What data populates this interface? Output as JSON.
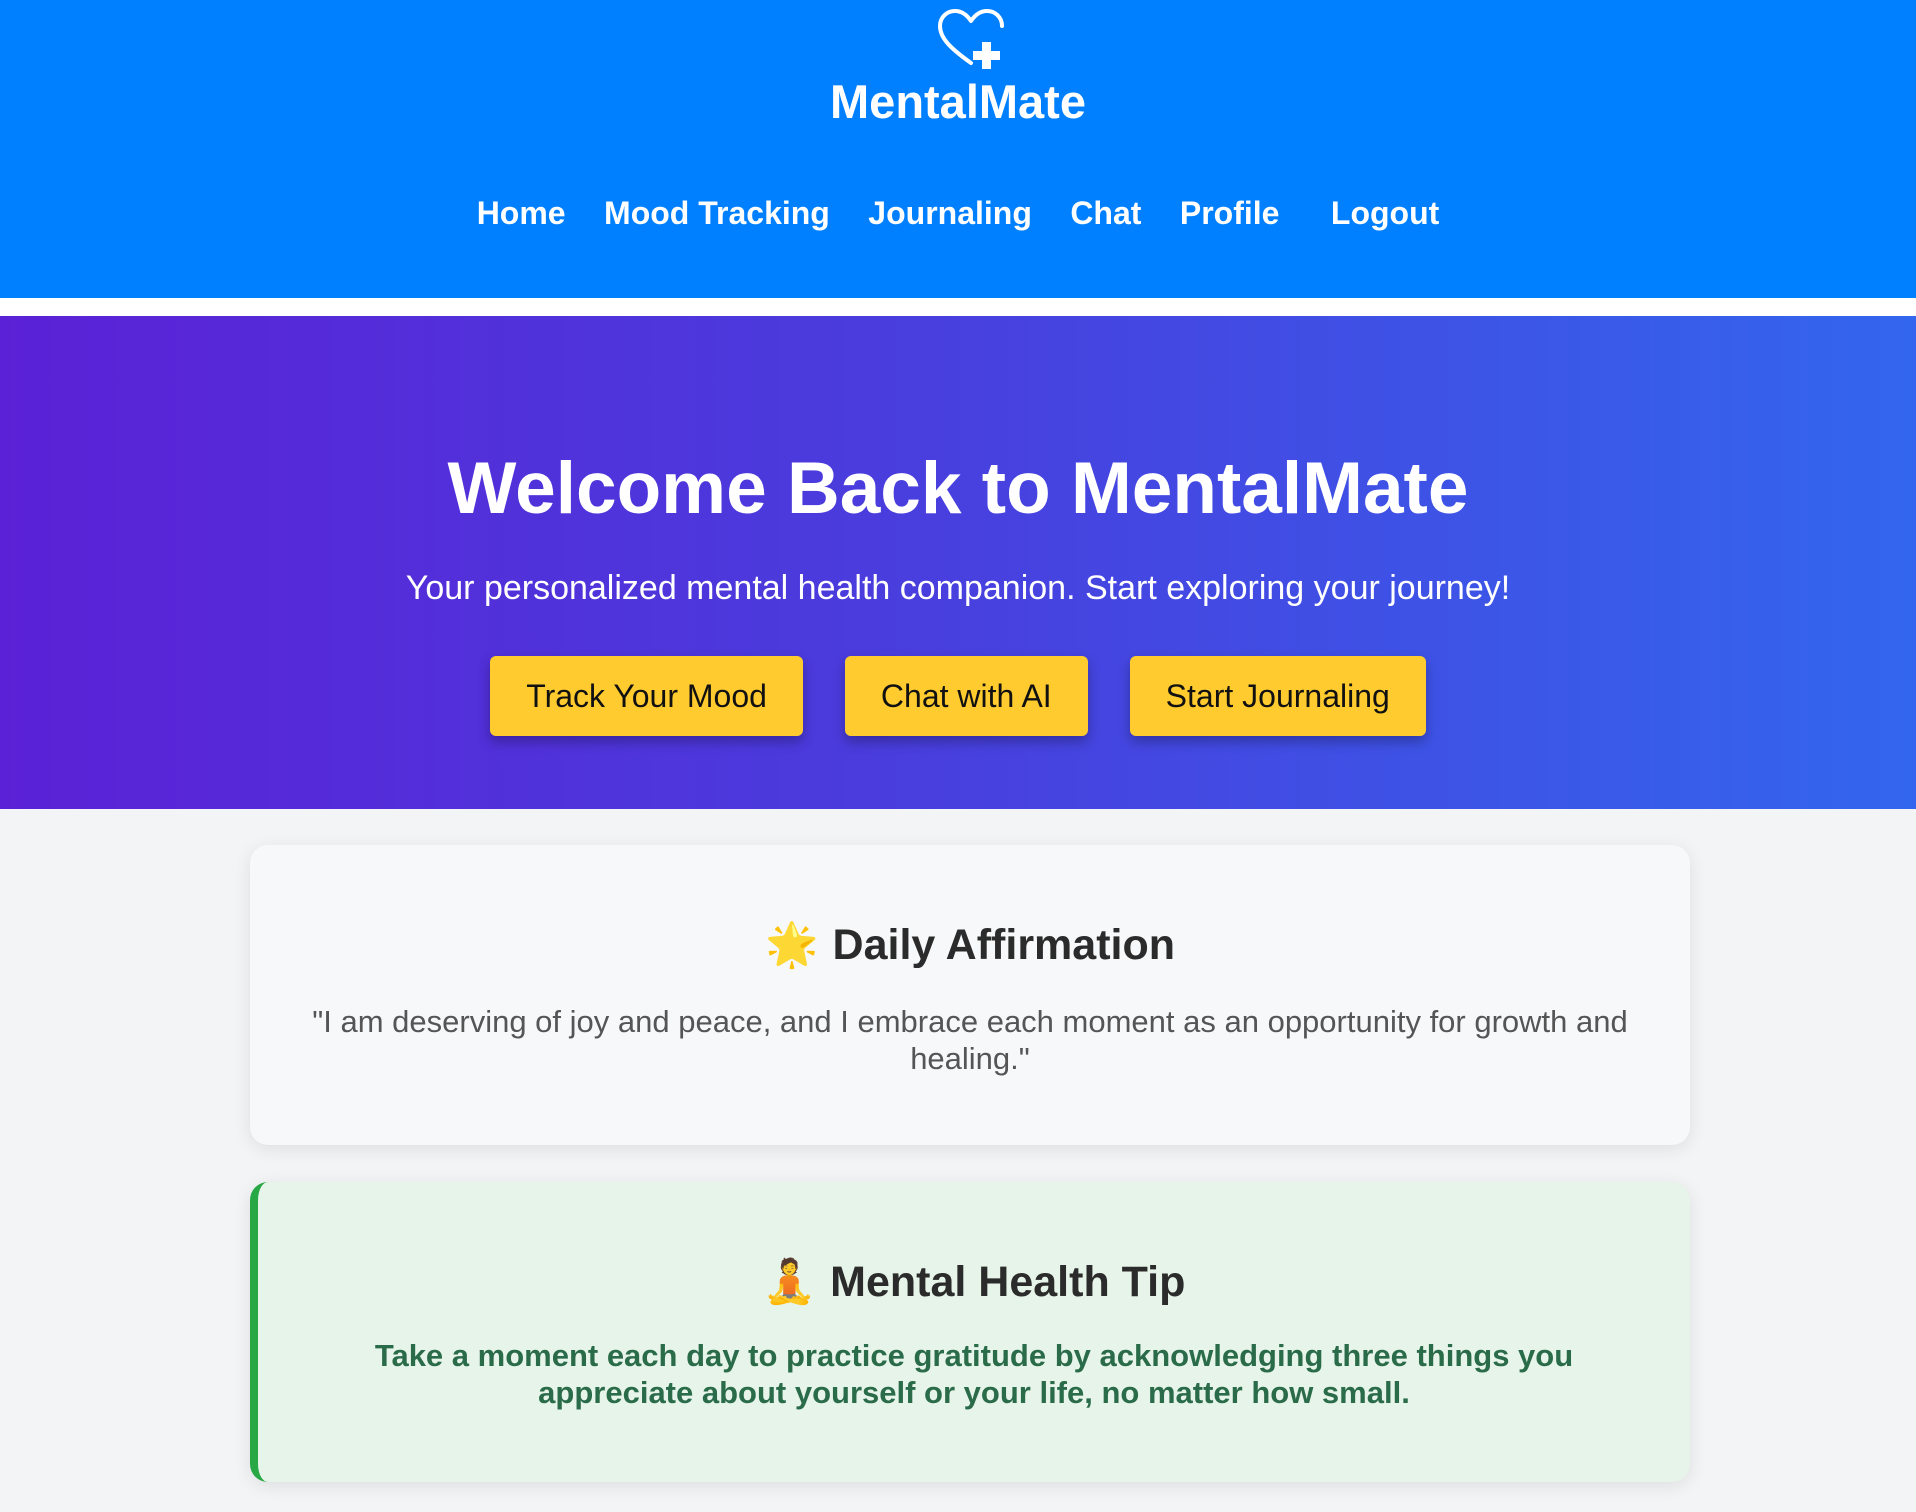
{
  "header": {
    "logo_icon": "heart-plus-icon",
    "brand": "MentalMate",
    "nav": [
      {
        "label": "Home"
      },
      {
        "label": "Mood Tracking"
      },
      {
        "label": "Journaling"
      },
      {
        "label": "Chat"
      },
      {
        "label": "Profile"
      },
      {
        "label": "Logout"
      }
    ]
  },
  "hero": {
    "title": "Welcome Back to MentalMate",
    "subtitle": "Your personalized mental health companion. Start exploring your journey!",
    "buttons": [
      {
        "label": "Track Your Mood"
      },
      {
        "label": "Chat with AI"
      },
      {
        "label": "Start Journaling"
      }
    ]
  },
  "affirmation": {
    "icon": "glowing-star-icon",
    "emoji": "🌟",
    "heading": "Daily Affirmation",
    "text": "\"I am deserving of joy and peace, and I embrace each moment as an opportunity for growth and healing.\""
  },
  "tip": {
    "icon": "meditation-icon",
    "emoji": "🧘",
    "heading": "Mental Health Tip",
    "text": "Take a moment each day to practice gratitude by acknowledging three things you appreciate about yourself or your life, no matter how small."
  },
  "colors": {
    "header_blue": "#0080ff",
    "hero_gradient_start": "#5b21d6",
    "hero_gradient_end": "#3366ee",
    "button_yellow": "#ffcb2e",
    "tip_accent_green": "#28a745",
    "tip_text_green": "#2a6b4a"
  }
}
